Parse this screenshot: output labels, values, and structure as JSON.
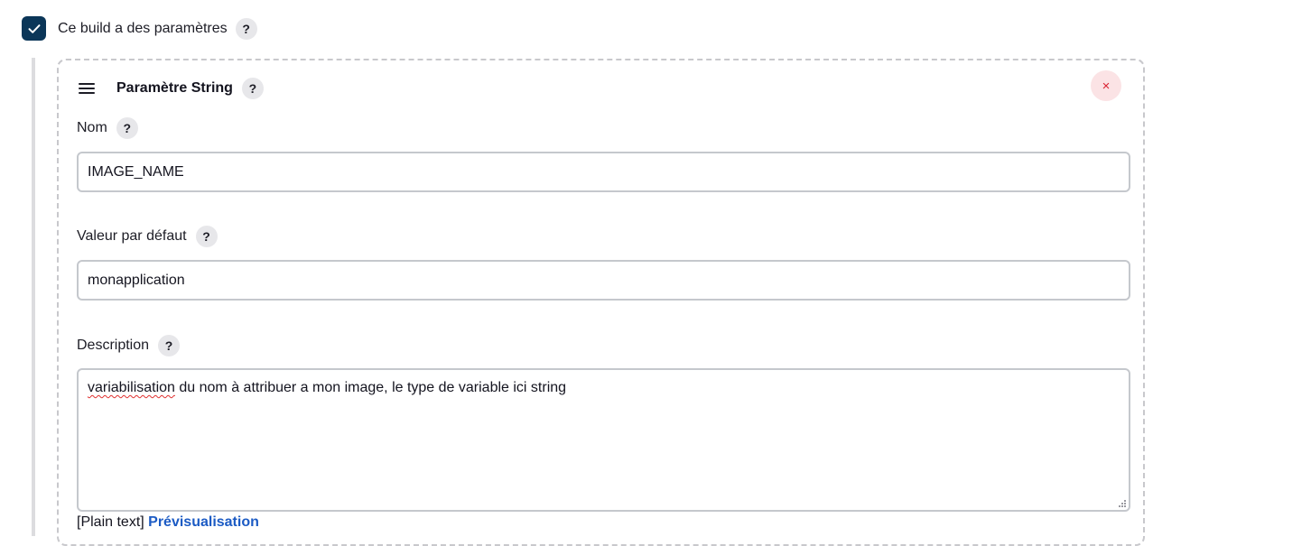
{
  "build_params": {
    "checkbox_checked": true,
    "label": "Ce build a des paramètres",
    "help": "?"
  },
  "parameter": {
    "title": "Paramètre String",
    "help": "?",
    "delete_symbol": "×",
    "fields": {
      "name": {
        "label": "Nom",
        "help": "?",
        "value": "IMAGE_NAME"
      },
      "default_value": {
        "label": "Valeur par défaut",
        "help": "?",
        "value": "monapplication"
      },
      "description": {
        "label": "Description",
        "help": "?",
        "value_misspelled": "variabilisation",
        "value_rest": " du nom à attribuer a mon image, le type de variable ici string"
      }
    },
    "format": {
      "plain_text": "[Plain text]",
      "preview_link": "Prévisualisation"
    }
  },
  "colors": {
    "checkbox_bg": "#0b3658",
    "delete_bg": "#fbe3e5",
    "delete_fg": "#d92232",
    "link": "#1c5bc4",
    "border": "#c5c8cd"
  },
  "icons": {
    "checkbox": "checkmark-icon",
    "drag": "drag-handle-icon",
    "delete": "close-icon",
    "resize": "resize-grip-icon"
  }
}
